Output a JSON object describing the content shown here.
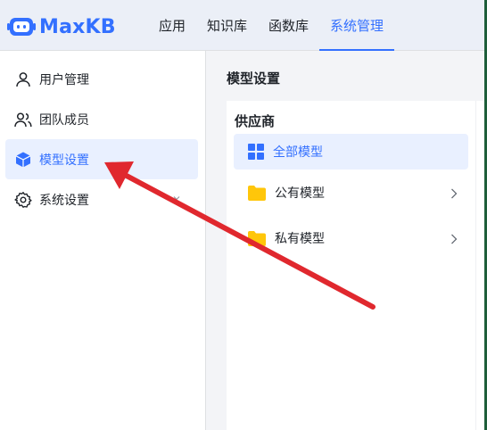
{
  "app": {
    "logo_text": "MaxKB"
  },
  "nav": {
    "items": [
      {
        "label": "应用"
      },
      {
        "label": "知识库"
      },
      {
        "label": "函数库"
      },
      {
        "label": "系统管理"
      }
    ],
    "active": "系统管理"
  },
  "sidebar": {
    "items": [
      {
        "label": "用户管理",
        "icon": "user-icon"
      },
      {
        "label": "团队成员",
        "icon": "team-icon"
      },
      {
        "label": "模型设置",
        "icon": "cube-icon",
        "active": true
      },
      {
        "label": "系统设置",
        "icon": "gear-icon"
      }
    ]
  },
  "main": {
    "title": "模型设置",
    "provider_header": "供应商",
    "providers": [
      {
        "label": "全部模型",
        "icon": "grid-icon",
        "active": true
      },
      {
        "label": "公有模型",
        "icon": "folder-icon"
      },
      {
        "label": "私有模型",
        "icon": "folder-icon"
      }
    ]
  },
  "colors": {
    "accent": "#3370ff",
    "folder": "#ffc60a",
    "arrow": "#e0282e",
    "header_bg": "#ebeff7",
    "active_bg": "#e9f0ff"
  }
}
